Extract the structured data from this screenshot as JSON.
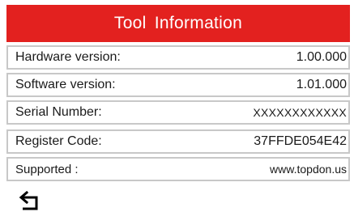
{
  "header": {
    "title": "Tool  Information",
    "color": "#e3211f"
  },
  "info_rows": [
    {
      "label": "Hardware version:",
      "value": "1.00.000"
    },
    {
      "label": "Software version:",
      "value": "1.01.000"
    },
    {
      "label": "Serial Number:",
      "value": "XXXXXXXXXXXX"
    },
    {
      "label": "Register Code:",
      "value": "37FFDE054E42"
    },
    {
      "label": "Supported :",
      "value": "www.topdon.us"
    }
  ],
  "footer": {
    "back_icon": "back-arrow-icon"
  }
}
